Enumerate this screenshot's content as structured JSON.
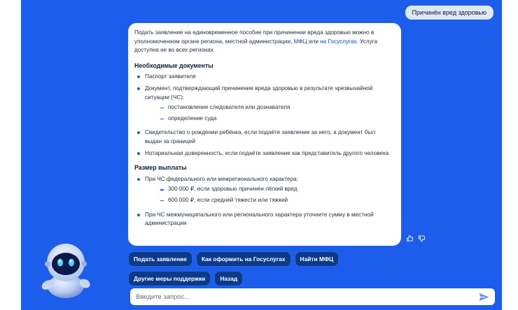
{
  "user_message": "Причинён вред здоровью",
  "answer": {
    "intro_text": "Подать заявление на единовременное пособие при причинении вреда здоровью можно в уполномоченном органе региона, местной администрации,",
    "intro_link_mfc": "МФЦ",
    "intro_or": "или",
    "intro_link_gosuslugi": "на Госуслугах",
    "intro_tail": ". Услуга доступна не во всех регионах",
    "documents": {
      "heading": "Необходимые документы",
      "items": [
        "Паспорт заявителя",
        "Документ, подтверждающий причинение вреда здоровью в результате чрезвычайной ситуации (ЧС):",
        "Свидетельство о рождении ребёнка, если подаёте заявление за него, а документ был выдан за границей",
        "Нотариальная доверенность, если подаёте заявление как представитель другого человека"
      ],
      "subitems": [
        "постановление следователя или дознавателя",
        "определение суда"
      ]
    },
    "payment": {
      "heading": "Размер выплаты",
      "items": [
        "При ЧС федерального или межрегионального характера:",
        "При ЧС межмуниципального или регионального характера уточните сумму в местной администрации"
      ],
      "subitems": [
        "300 000 ₽, если здоровью причинён лёгкий вред",
        "600 000 ₽, если средней тяжести или тяжкий"
      ]
    }
  },
  "feedback": {
    "like_icon": "thumbs-up-icon",
    "dislike_icon": "thumbs-down-icon"
  },
  "quick_replies": [
    "Подать заявление",
    "Как оформить на Госуслугах",
    "Найти МФЦ",
    "Другие меры поддержки",
    "Назад"
  ],
  "input": {
    "placeholder": "Введите запрос..."
  },
  "colors": {
    "background": "#1d5deb",
    "chip": "#0c3a8a",
    "link": "#0d4cd3",
    "user_bubble": "#dfe7f2"
  }
}
